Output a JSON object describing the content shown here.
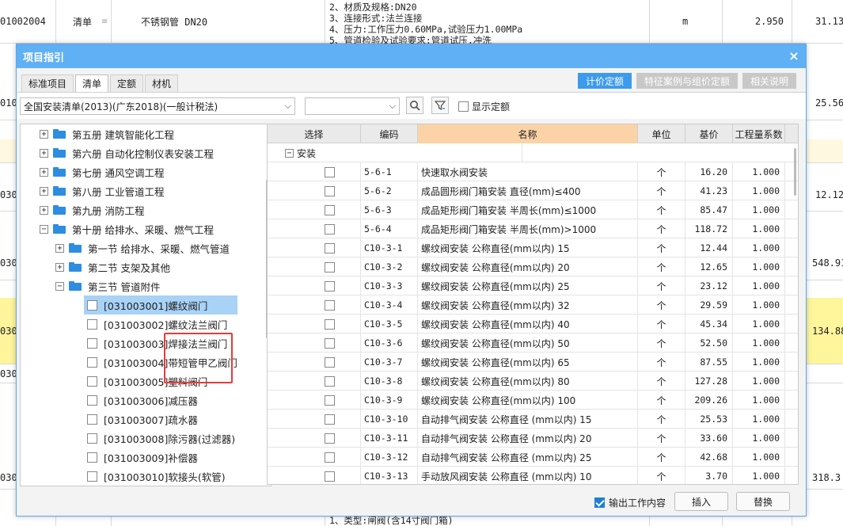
{
  "background": {
    "rows": [
      {
        "code": "01002004",
        "type": "清单",
        "name": "不锈钢管 DN20",
        "unit": "m",
        "qty": "2.950",
        "amount": "31.13",
        "desc": "2、材质及规格:DN20\n3、连接形式:法兰连接\n4、压力:工作压力0.60MPa,试验压力1.00MPa\n5、管道检验及试验要求:管道试压,冲洗"
      },
      {
        "code": "010",
        "amount": "25.56"
      },
      {
        "code": "030",
        "amount": "12.12"
      },
      {
        "code": "030",
        "amount": "548.91"
      },
      {
        "code": "030",
        "amount": "134.88"
      },
      {
        "code": "030",
        "amount": ""
      },
      {
        "code": "030",
        "amount": "318.3"
      }
    ],
    "bottom_desc": "1、类型:闸阀(含14寸阀门箱)"
  },
  "dialog": {
    "title": "项目指引",
    "close_glyph": "×",
    "tabs": [
      "标准项目",
      "清单",
      "定额",
      "材机"
    ],
    "active_tab": 1,
    "top_buttons": [
      "计价定额",
      "特征案例与组价定额",
      "相关说明"
    ],
    "active_top_button": 0,
    "library_select": "全国安装清单(2013)(广东2018)(一般计税法)",
    "dropdown_arrow": "⌵",
    "show_quota_label": "显示定额",
    "tree": [
      {
        "toggle": "+",
        "label": "第五册   建筑智能化工程",
        "level": 0,
        "folder": true
      },
      {
        "toggle": "+",
        "label": "第六册   自动化控制仪表安装工程",
        "level": 0,
        "folder": true
      },
      {
        "toggle": "+",
        "label": "第七册   通风空调工程",
        "level": 0,
        "folder": true
      },
      {
        "toggle": "+",
        "label": "第八册   工业管道工程",
        "level": 0,
        "folder": true
      },
      {
        "toggle": "+",
        "label": "第九册   消防工程",
        "level": 0,
        "folder": true
      },
      {
        "toggle": "−",
        "label": "第十册   给排水、采暖、燃气工程",
        "level": 0,
        "folder": true
      },
      {
        "toggle": "+",
        "label": "第一节  给排水、采暖、燃气管道",
        "level": 1,
        "folder": true
      },
      {
        "toggle": "+",
        "label": "第二节   支架及其他",
        "level": 1,
        "folder": true
      },
      {
        "toggle": "−",
        "label": "第三节   管道附件",
        "level": 1,
        "folder": true
      },
      {
        "label": "[031003001]螺纹阀门",
        "level": 2,
        "selected": true
      },
      {
        "label": "[031003002]螺纹法兰阀门",
        "level": 2
      },
      {
        "label": "[031003003]焊接法兰阀门",
        "level": 2
      },
      {
        "label": "[031003004]带短管甲乙阀门",
        "level": 2
      },
      {
        "label": "[031003005]塑料阀门",
        "level": 2
      },
      {
        "label": "[031003006]减压器",
        "level": 2
      },
      {
        "label": "[031003007]疏水器",
        "level": 2
      },
      {
        "label": "[031003008]除污器(过滤器)",
        "level": 2
      },
      {
        "label": "[031003009]补偿器",
        "level": 2
      },
      {
        "label": "[031003010]软接头(软管)",
        "level": 2
      }
    ],
    "grid": {
      "headers": [
        "选择",
        "编码",
        "名称",
        "单位",
        "基价",
        "工程量系数"
      ],
      "group_label": "安装",
      "group_toggle": "−",
      "rows": [
        {
          "code": "5-6-1",
          "name": "快速取水阀安装",
          "unit": "个",
          "price": "16.20",
          "factor": "1.000"
        },
        {
          "code": "5-6-2",
          "name": "成品圆形阀门箱安装 直径(mm)≤400",
          "unit": "个",
          "price": "41.23",
          "factor": "1.000"
        },
        {
          "code": "5-6-3",
          "name": "成品矩形阀门箱安装 半周长(mm)≤1000",
          "unit": "个",
          "price": "85.47",
          "factor": "1.000"
        },
        {
          "code": "5-6-4",
          "name": "成品矩形阀门箱安装 半周长(mm)>1000",
          "unit": "个",
          "price": "118.72",
          "factor": "1.000"
        },
        {
          "code": "C10-3-1",
          "name": "螺纹阀安装 公称直径(mm以内) 15",
          "unit": "个",
          "price": "12.44",
          "factor": "1.000"
        },
        {
          "code": "C10-3-2",
          "name": "螺纹阀安装 公称直径(mm以内) 20",
          "unit": "个",
          "price": "12.65",
          "factor": "1.000"
        },
        {
          "code": "C10-3-3",
          "name": "螺纹阀安装 公称直径(mm以内) 25",
          "unit": "个",
          "price": "23.12",
          "factor": "1.000"
        },
        {
          "code": "C10-3-4",
          "name": "螺纹阀安装 公称直径(mm以内) 32",
          "unit": "个",
          "price": "29.59",
          "factor": "1.000"
        },
        {
          "code": "C10-3-5",
          "name": "螺纹阀安装 公称直径(mm以内) 40",
          "unit": "个",
          "price": "45.34",
          "factor": "1.000"
        },
        {
          "code": "C10-3-6",
          "name": "螺纹阀安装 公称直径(mm以内) 50",
          "unit": "个",
          "price": "52.50",
          "factor": "1.000"
        },
        {
          "code": "C10-3-7",
          "name": "螺纹阀安装 公称直径(mm以内) 65",
          "unit": "个",
          "price": "87.55",
          "factor": "1.000"
        },
        {
          "code": "C10-3-8",
          "name": "螺纹阀安装 公称直径(mm以内) 80",
          "unit": "个",
          "price": "127.28",
          "factor": "1.000"
        },
        {
          "code": "C10-3-9",
          "name": "螺纹阀安装 公称直径(mm以内) 100",
          "unit": "个",
          "price": "209.26",
          "factor": "1.000"
        },
        {
          "code": "C10-3-10",
          "name": "自动排气阀安装 公称直径 (mm以内)  15",
          "unit": "个",
          "price": "25.53",
          "factor": "1.000"
        },
        {
          "code": "C10-3-11",
          "name": "自动排气阀安装 公称直径 (mm以内)  20",
          "unit": "个",
          "price": "33.60",
          "factor": "1.000"
        },
        {
          "code": "C10-3-12",
          "name": "自动排气阀安装 公称直径 (mm以内)  25",
          "unit": "个",
          "price": "42.68",
          "factor": "1.000"
        },
        {
          "code": "C10-3-13",
          "name": "手动放风阀安装 公称直径 (mm以内)  10",
          "unit": "个",
          "price": "3.70",
          "factor": "1.000"
        }
      ]
    },
    "output_work_label": "输出工作内容",
    "insert_label": "插入",
    "replace_label": "替换",
    "colors": {
      "title_bar": "#5fb0f4",
      "active_button": "#3c9bec",
      "highlight_header": "#fbd3a7",
      "selection": "#a8d2f6",
      "red_box": "#e83a3a"
    }
  }
}
